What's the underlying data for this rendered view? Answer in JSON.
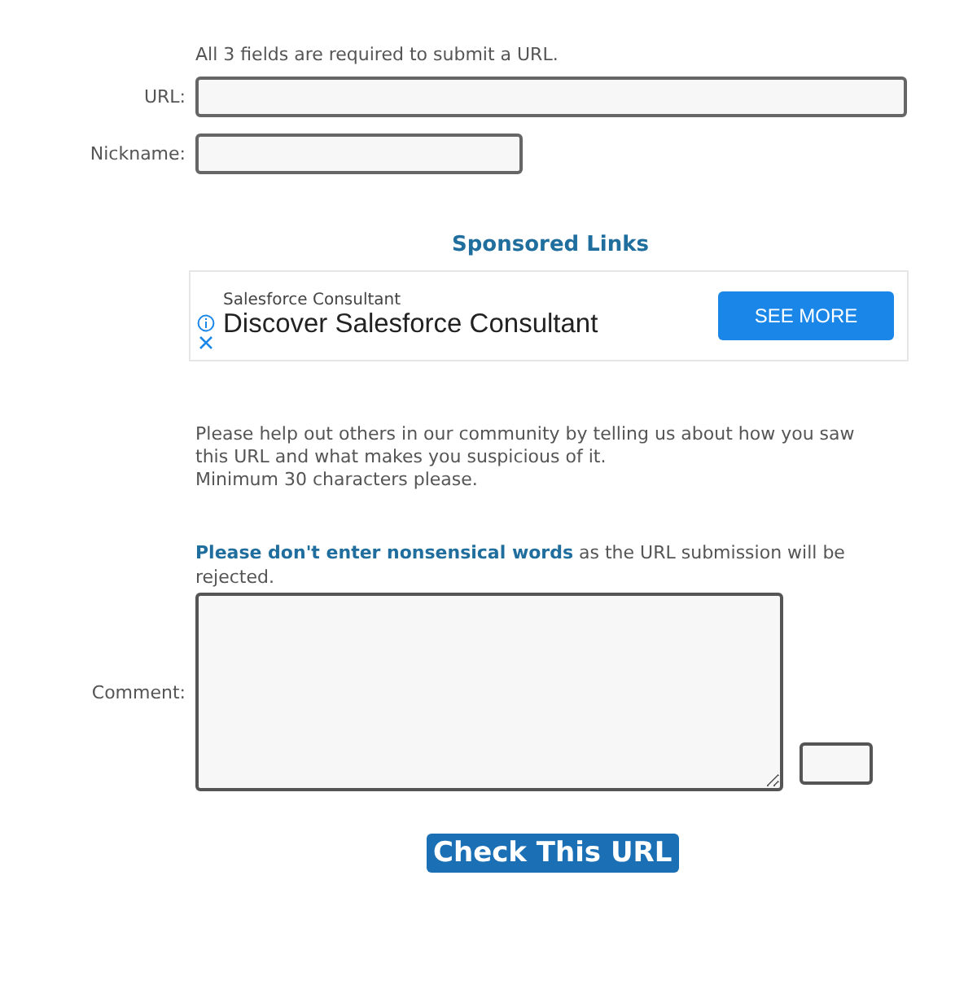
{
  "intro": "All 3 fields are required to submit a URL.",
  "fields": [
    {
      "label": "URL:",
      "kind": "wide"
    },
    {
      "label": "Nickname:",
      "kind": "short"
    }
  ],
  "sponsored": {
    "heading": "Sponsored Links",
    "ad": {
      "advertiser": "Salesforce Consultant",
      "headline": "Discover Salesforce Consultant",
      "button": "SEE MORE"
    }
  },
  "help": "Please help out others in our community by telling us about how you saw this URL and what makes you suspicious of it.",
  "minimum": "Minimum 30 characters please.",
  "warning": "**Please don't enter nonsensical words** as the URL submission will be rejected.",
  "comment": {
    "label": "Comment:"
  },
  "submit": "Check This URL"
}
